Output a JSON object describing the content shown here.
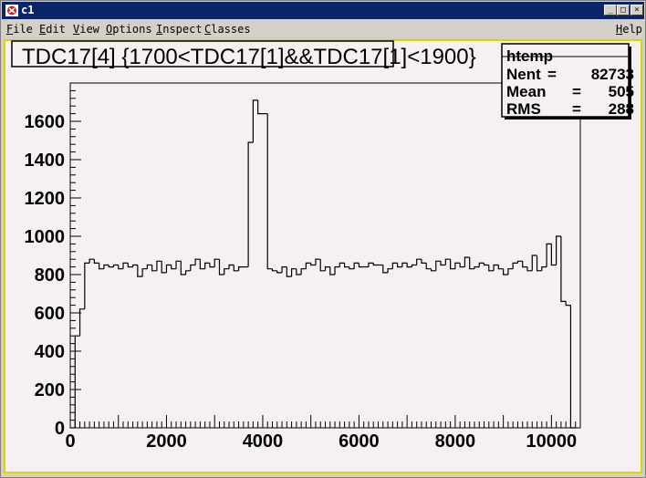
{
  "window": {
    "title": "c1",
    "controls": {
      "minimize": "_",
      "maximize": "□",
      "close": "×"
    }
  },
  "menu": {
    "items": [
      {
        "mnemonic": "F",
        "rest": "ile"
      },
      {
        "mnemonic": "E",
        "rest": "dit"
      },
      {
        "mnemonic": "V",
        "rest": "iew"
      },
      {
        "mnemonic": "O",
        "rest": "ptions"
      },
      {
        "mnemonic": "I",
        "rest": "nspect"
      },
      {
        "mnemonic": "C",
        "rest": "lasses"
      }
    ],
    "help": {
      "mnemonic": "H",
      "rest": "elp"
    }
  },
  "colors": {
    "title_bar": "#0a246a",
    "canvas_frame": "#d8d800",
    "pad_background": "#f4f0f4",
    "histogram_line": "#000000"
  },
  "chart_data": {
    "type": "histogram",
    "title": "TDC17[4] {1700<TDC17[1]&&TDC17[1]<1900}",
    "stats": {
      "name": "htemp",
      "rows": [
        {
          "label": "Nent",
          "value": "82733"
        },
        {
          "label": "Mean",
          "value": "505"
        },
        {
          "label": "RMS",
          "value": "288"
        }
      ]
    },
    "xlim": [
      0,
      10600
    ],
    "ylim": [
      0,
      1800
    ],
    "x_ticks": [
      0,
      2000,
      4000,
      6000,
      8000,
      10000
    ],
    "y_ticks": [
      0,
      200,
      400,
      600,
      800,
      1000,
      1200,
      1400,
      1600
    ],
    "bins": [
      [
        0,
        100,
        0
      ],
      [
        100,
        200,
        480
      ],
      [
        200,
        300,
        620
      ],
      [
        300,
        400,
        860
      ],
      [
        400,
        500,
        880
      ],
      [
        500,
        600,
        860
      ],
      [
        600,
        700,
        830
      ],
      [
        700,
        800,
        850
      ],
      [
        800,
        900,
        840
      ],
      [
        900,
        1000,
        850
      ],
      [
        1000,
        1100,
        830
      ],
      [
        1100,
        1200,
        860
      ],
      [
        1200,
        1300,
        840
      ],
      [
        1300,
        1400,
        850
      ],
      [
        1400,
        1500,
        790
      ],
      [
        1500,
        1600,
        830
      ],
      [
        1600,
        1700,
        850
      ],
      [
        1700,
        1800,
        820
      ],
      [
        1800,
        1900,
        870
      ],
      [
        1900,
        2000,
        810
      ],
      [
        2000,
        2100,
        850
      ],
      [
        2100,
        2200,
        830
      ],
      [
        2200,
        2300,
        870
      ],
      [
        2300,
        2400,
        800
      ],
      [
        2400,
        2500,
        820
      ],
      [
        2500,
        2600,
        850
      ],
      [
        2600,
        2700,
        880
      ],
      [
        2700,
        2800,
        830
      ],
      [
        2800,
        2900,
        860
      ],
      [
        2900,
        3000,
        840
      ],
      [
        3000,
        3100,
        880
      ],
      [
        3100,
        3200,
        800
      ],
      [
        3200,
        3300,
        830
      ],
      [
        3300,
        3400,
        850
      ],
      [
        3400,
        3500,
        820
      ],
      [
        3500,
        3600,
        840
      ],
      [
        3600,
        3700,
        840
      ],
      [
        3700,
        3800,
        1490
      ],
      [
        3800,
        3900,
        1710
      ],
      [
        3900,
        4000,
        1640
      ],
      [
        4000,
        4100,
        1640
      ],
      [
        4100,
        4200,
        830
      ],
      [
        4200,
        4300,
        820
      ],
      [
        4300,
        4400,
        810
      ],
      [
        4400,
        4500,
        840
      ],
      [
        4500,
        4600,
        790
      ],
      [
        4600,
        4700,
        830
      ],
      [
        4700,
        4800,
        800
      ],
      [
        4800,
        4900,
        830
      ],
      [
        4900,
        5000,
        860
      ],
      [
        5000,
        5100,
        850
      ],
      [
        5100,
        5200,
        880
      ],
      [
        5200,
        5300,
        820
      ],
      [
        5300,
        5400,
        840
      ],
      [
        5400,
        5500,
        800
      ],
      [
        5500,
        5600,
        840
      ],
      [
        5600,
        5700,
        860
      ],
      [
        5700,
        5800,
        840
      ],
      [
        5800,
        5900,
        830
      ],
      [
        5900,
        6000,
        860
      ],
      [
        6000,
        6100,
        840
      ],
      [
        6100,
        6200,
        840
      ],
      [
        6200,
        6300,
        860
      ],
      [
        6300,
        6400,
        850
      ],
      [
        6400,
        6500,
        850
      ],
      [
        6500,
        6600,
        810
      ],
      [
        6600,
        6700,
        830
      ],
      [
        6700,
        6800,
        860
      ],
      [
        6800,
        6900,
        840
      ],
      [
        6900,
        7000,
        860
      ],
      [
        7000,
        7100,
        840
      ],
      [
        7100,
        7200,
        850
      ],
      [
        7200,
        7300,
        880
      ],
      [
        7300,
        7400,
        860
      ],
      [
        7400,
        7500,
        830
      ],
      [
        7500,
        7600,
        820
      ],
      [
        7600,
        7700,
        870
      ],
      [
        7700,
        7800,
        850
      ],
      [
        7800,
        7900,
        880
      ],
      [
        7900,
        8000,
        830
      ],
      [
        8000,
        8100,
        860
      ],
      [
        8100,
        8200,
        840
      ],
      [
        8200,
        8300,
        890
      ],
      [
        8300,
        8400,
        830
      ],
      [
        8400,
        8500,
        840
      ],
      [
        8500,
        8600,
        860
      ],
      [
        8600,
        8700,
        850
      ],
      [
        8700,
        8800,
        820
      ],
      [
        8800,
        8900,
        850
      ],
      [
        8900,
        9000,
        830
      ],
      [
        9000,
        9100,
        800
      ],
      [
        9100,
        9200,
        830
      ],
      [
        9200,
        9300,
        860
      ],
      [
        9300,
        9400,
        870
      ],
      [
        9400,
        9500,
        840
      ],
      [
        9500,
        9600,
        820
      ],
      [
        9600,
        9700,
        900
      ],
      [
        9700,
        9800,
        820
      ],
      [
        9800,
        9900,
        840
      ],
      [
        9900,
        10000,
        960
      ],
      [
        10000,
        10100,
        850
      ],
      [
        10100,
        10200,
        1000
      ],
      [
        10200,
        10300,
        660
      ],
      [
        10300,
        10400,
        640
      ],
      [
        10400,
        10500,
        0
      ]
    ]
  }
}
